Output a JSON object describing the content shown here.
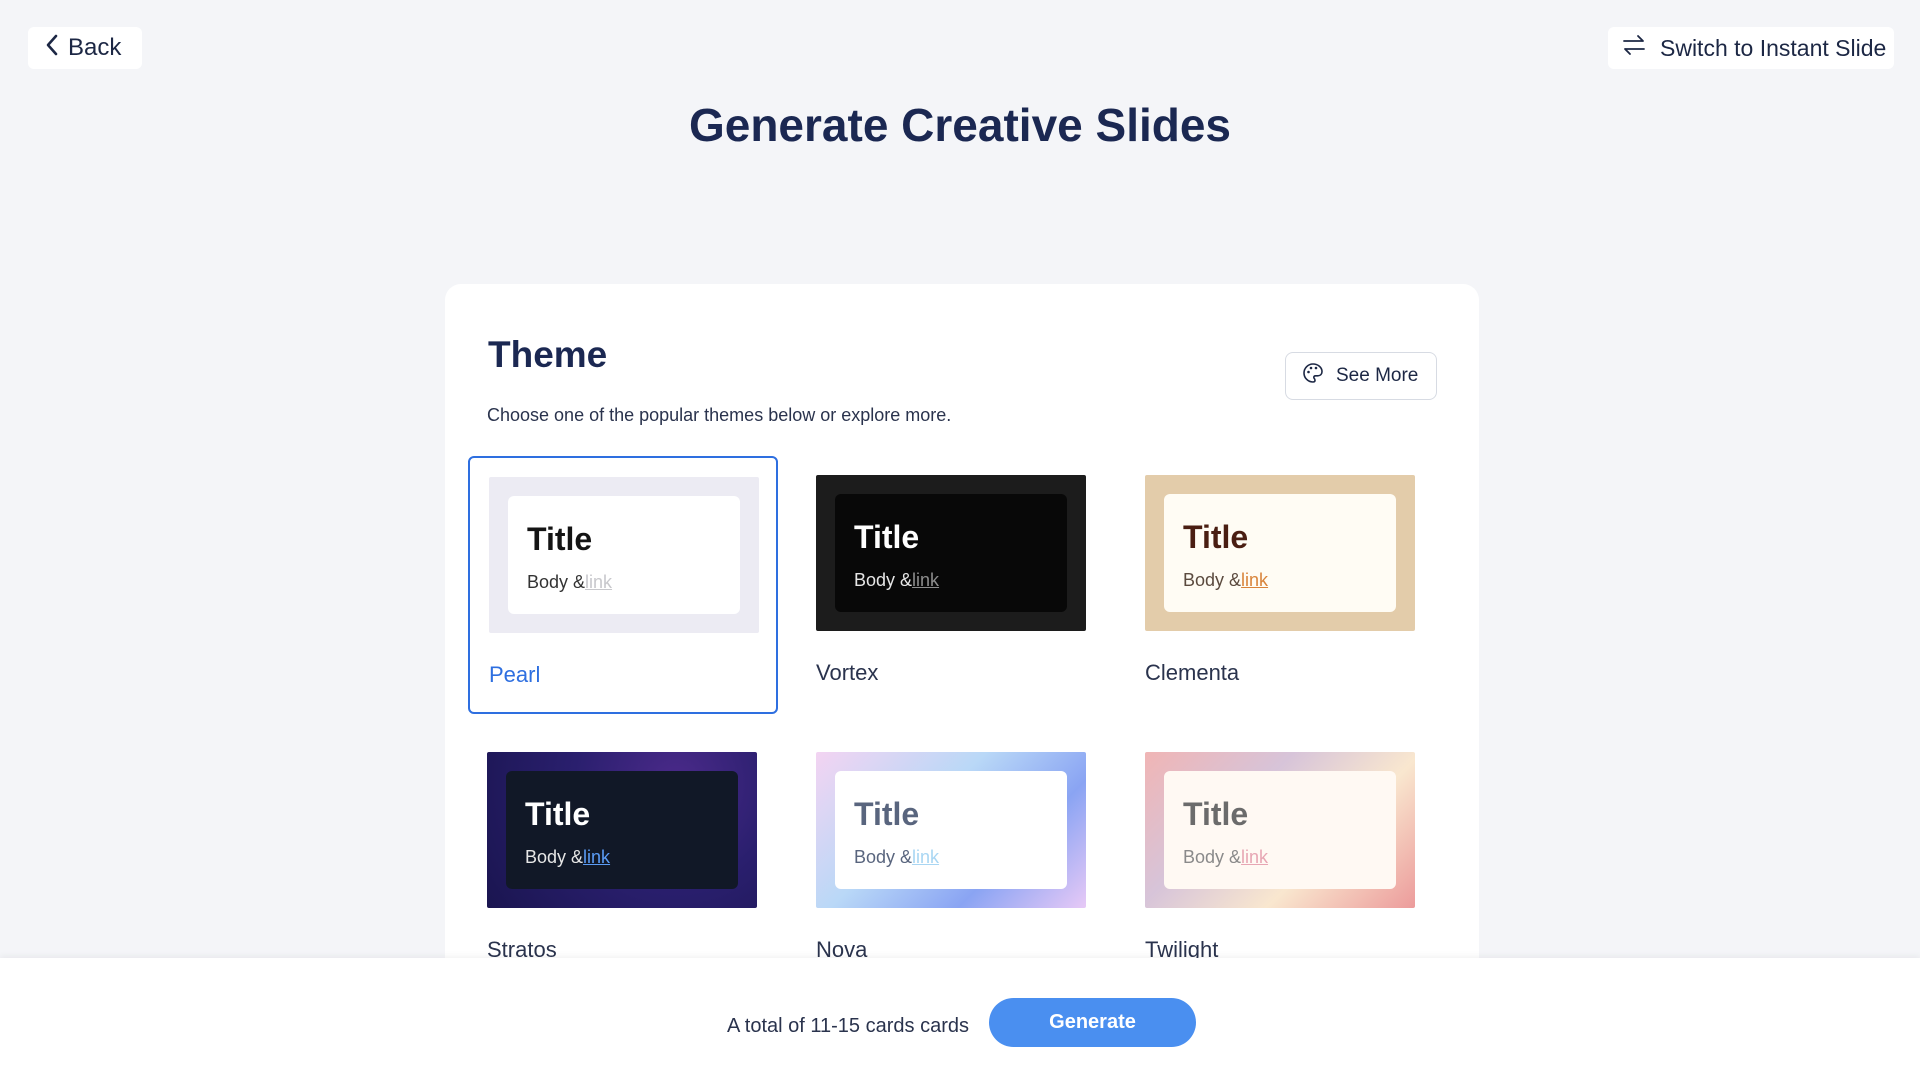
{
  "header": {
    "back_label": "Back",
    "switch_label": "Switch to Instant Slide",
    "page_title": "Generate Creative Slides"
  },
  "theme_section": {
    "heading": "Theme",
    "subtitle": "Choose one of the popular themes below or explore more.",
    "see_more_label": "See More",
    "selected": "Pearl",
    "themes": [
      {
        "name": "Pearl",
        "title": "Title",
        "body": "Body &",
        "link": "link",
        "colors": {
          "outer": "#ecebf3",
          "inner": "#ffffff",
          "title": "#141414",
          "body": "#333333",
          "link": "#c8c8cc"
        }
      },
      {
        "name": "Vortex",
        "title": "Title",
        "body": "Body &",
        "link": "link",
        "colors": {
          "outer": "#1c1c1c",
          "inner": "#080808",
          "title": "#ffffff",
          "body": "#e6e6e6",
          "link": "#8d8d8d"
        }
      },
      {
        "name": "Clementa",
        "title": "Title",
        "body": "Body &",
        "link": "link",
        "colors": {
          "outer": "#e3ccaa",
          "inner": "#fffcf4",
          "title": "#4a1e12",
          "body": "#5b4a3e",
          "link": "#d9843a"
        }
      },
      {
        "name": "Stratos",
        "title": "Title",
        "body": "Body &",
        "link": "link",
        "colors": {
          "outer": "#2a1f6e",
          "inner": "#111827",
          "title": "#ffffff",
          "body": "#e6e6e6",
          "link": "#5b9cf5"
        }
      },
      {
        "name": "Nova",
        "title": "Title",
        "body": "Body &",
        "link": "link",
        "colors": {
          "outer": "#c9c7f5",
          "inner": "#ffffff",
          "title": "#59657e",
          "body": "#59657e",
          "link": "#a9d6f3"
        }
      },
      {
        "name": "Twilight",
        "title": "Title",
        "body": "Body &",
        "link": "link",
        "colors": {
          "outer": "#e9c3c1",
          "inner": "#fff9f3",
          "title": "#6b6b6b",
          "body": "#8a8a8a",
          "link": "#e7a6b3"
        }
      }
    ]
  },
  "footer": {
    "total_text": "A total of 11-15 cards cards",
    "generate_label": "Generate"
  },
  "colors": {
    "accent": "#2e6fe0",
    "primary_button": "#4a8ff0",
    "background": "#f4f5f8"
  }
}
